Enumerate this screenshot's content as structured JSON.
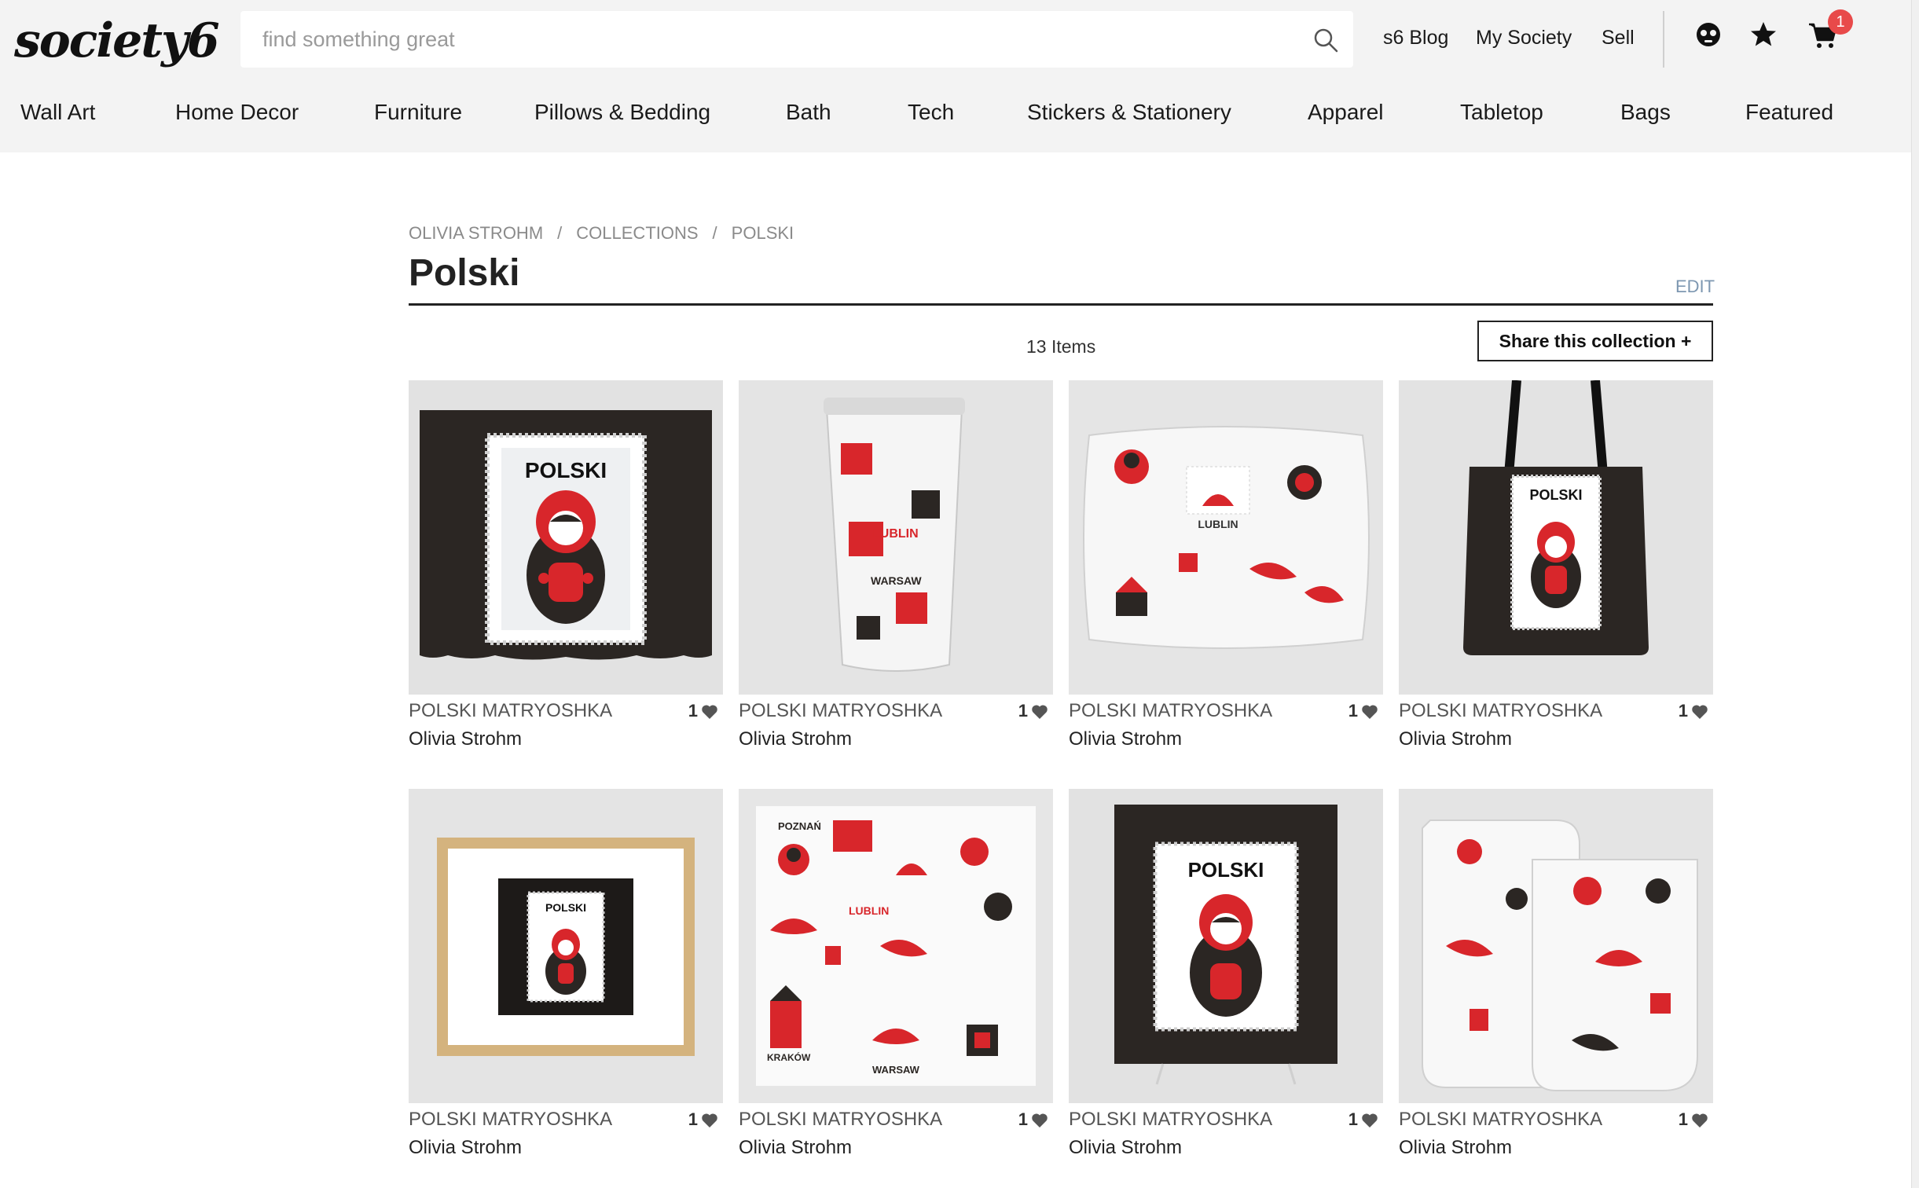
{
  "header": {
    "logo": "society6",
    "search_placeholder": "find something great",
    "links": [
      {
        "label": "s6 Blog"
      },
      {
        "label": "My Society"
      },
      {
        "label": "Sell"
      }
    ],
    "cart_count": "1"
  },
  "nav": [
    {
      "label": "Wall Art"
    },
    {
      "label": "Home Decor"
    },
    {
      "label": "Furniture"
    },
    {
      "label": "Pillows & Bedding"
    },
    {
      "label": "Bath"
    },
    {
      "label": "Tech"
    },
    {
      "label": "Stickers & Stationery"
    },
    {
      "label": "Apparel"
    },
    {
      "label": "Tabletop"
    },
    {
      "label": "Bags"
    },
    {
      "label": "Featured"
    }
  ],
  "breadcrumb": [
    "OLIVIA STROHM",
    "COLLECTIONS",
    "POLSKI"
  ],
  "page": {
    "title": "Polski",
    "edit_label": "EDIT",
    "items_count": "13 Items",
    "share_label": "Share this collection +"
  },
  "products": [
    {
      "title": "POLSKI MATRYOSHKA",
      "artist": "Olivia Strohm",
      "likes": "1",
      "image": "wall-tapestry"
    },
    {
      "title": "POLSKI MATRYOSHKA",
      "artist": "Olivia Strohm",
      "likes": "1",
      "image": "travel-mug"
    },
    {
      "title": "POLSKI MATRYOSHKA",
      "artist": "Olivia Strohm",
      "likes": "1",
      "image": "throw-pillow"
    },
    {
      "title": "POLSKI MATRYOSHKA",
      "artist": "Olivia Strohm",
      "likes": "1",
      "image": "tote-bag"
    },
    {
      "title": "POLSKI MATRYOSHKA",
      "artist": "Olivia Strohm",
      "likes": "1",
      "image": "framed-print"
    },
    {
      "title": "POLSKI MATRYOSHKA",
      "artist": "Olivia Strohm",
      "likes": "1",
      "image": "pattern-print"
    },
    {
      "title": "POLSKI MATRYOSHKA",
      "artist": "Olivia Strohm",
      "likes": "1",
      "image": "shower-curtain"
    },
    {
      "title": "POLSKI MATRYOSHKA",
      "artist": "Olivia Strohm",
      "likes": "1",
      "image": "bath-mat"
    }
  ],
  "art_text": {
    "polski": "POLSKI",
    "lublin": "LUBLIN",
    "warsaw": "WARSAW",
    "krakow": "KRAKÓW",
    "poznan": "POZNAŃ"
  },
  "colors": {
    "header_bg": "#f3f3f3",
    "doll_red": "#d8262b",
    "dark": "#2b2623",
    "edit_link": "#7d97b1",
    "badge": "#e84a4a"
  }
}
